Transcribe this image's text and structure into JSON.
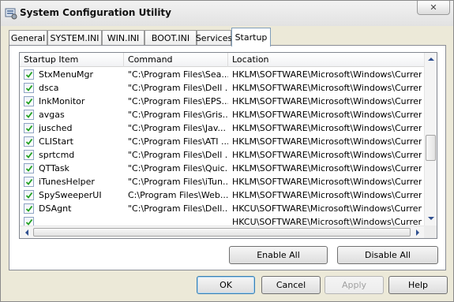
{
  "window": {
    "title": "System Configuration Utility",
    "close_glyph": "✕"
  },
  "tabs": [
    {
      "label": "General"
    },
    {
      "label": "SYSTEM.INI"
    },
    {
      "label": "WIN.INI"
    },
    {
      "label": "BOOT.INI"
    },
    {
      "label": "Services"
    },
    {
      "label": "Startup",
      "active": true
    }
  ],
  "startup_list": {
    "columns": [
      "Startup Item",
      "Command",
      "Location"
    ],
    "rows": [
      {
        "checked": true,
        "item": "StxMenuMgr",
        "command": "\"C:\\Program Files\\Sea...",
        "location": "HKLM\\SOFTWARE\\Microsoft\\Windows\\CurrentVer..."
      },
      {
        "checked": true,
        "item": "dsca",
        "command": "\"C:\\Program Files\\Dell ...",
        "location": "HKLM\\SOFTWARE\\Microsoft\\Windows\\CurrentVer..."
      },
      {
        "checked": true,
        "item": "InkMonitor",
        "command": "\"C:\\Program Files\\EPS...",
        "location": "HKLM\\SOFTWARE\\Microsoft\\Windows\\CurrentVer..."
      },
      {
        "checked": true,
        "item": "avgas",
        "command": "\"C:\\Program Files\\Gris...",
        "location": "HKLM\\SOFTWARE\\Microsoft\\Windows\\CurrentVer..."
      },
      {
        "checked": true,
        "item": "jusched",
        "command": "\"C:\\Program Files\\Jav...",
        "location": "HKLM\\SOFTWARE\\Microsoft\\Windows\\CurrentVer..."
      },
      {
        "checked": true,
        "item": "CLIStart",
        "command": "\"C:\\Program Files\\ATI ...",
        "location": "HKLM\\SOFTWARE\\Microsoft\\Windows\\CurrentVer..."
      },
      {
        "checked": true,
        "item": "sprtcmd",
        "command": "\"C:\\Program Files\\Dell ...",
        "location": "HKLM\\SOFTWARE\\Microsoft\\Windows\\CurrentVer..."
      },
      {
        "checked": true,
        "item": "QTTask",
        "command": "\"C:\\Program Files\\Quic...",
        "location": "HKLM\\SOFTWARE\\Microsoft\\Windows\\CurrentVer..."
      },
      {
        "checked": true,
        "item": "iTunesHelper",
        "command": "\"C:\\Program Files\\iTun...",
        "location": "HKLM\\SOFTWARE\\Microsoft\\Windows\\CurrentVer..."
      },
      {
        "checked": true,
        "item": "SpySweeperUI",
        "command": "C:\\Program Files\\Web...",
        "location": "HKLM\\SOFTWARE\\Microsoft\\Windows\\CurrentVer..."
      },
      {
        "checked": true,
        "item": "DSAgnt",
        "command": "\"C:\\Program Files\\Dell...",
        "location": "HKCU\\SOFTWARE\\Microsoft\\Windows\\CurrentVer..."
      },
      {
        "checked": true,
        "item": "",
        "command": "",
        "location": "HKCU\\SOFTWARE\\Microsoft\\Windows\\CurrentVer..."
      }
    ]
  },
  "buttons": {
    "enable_all": "Enable All",
    "disable_all": "Disable All",
    "ok": "OK",
    "cancel": "Cancel",
    "apply": "Apply",
    "help": "Help"
  },
  "colors": {
    "check_mark": "#21a121",
    "dialog_face": "#ece9d8",
    "tab_active_border": "#7f9db9"
  }
}
